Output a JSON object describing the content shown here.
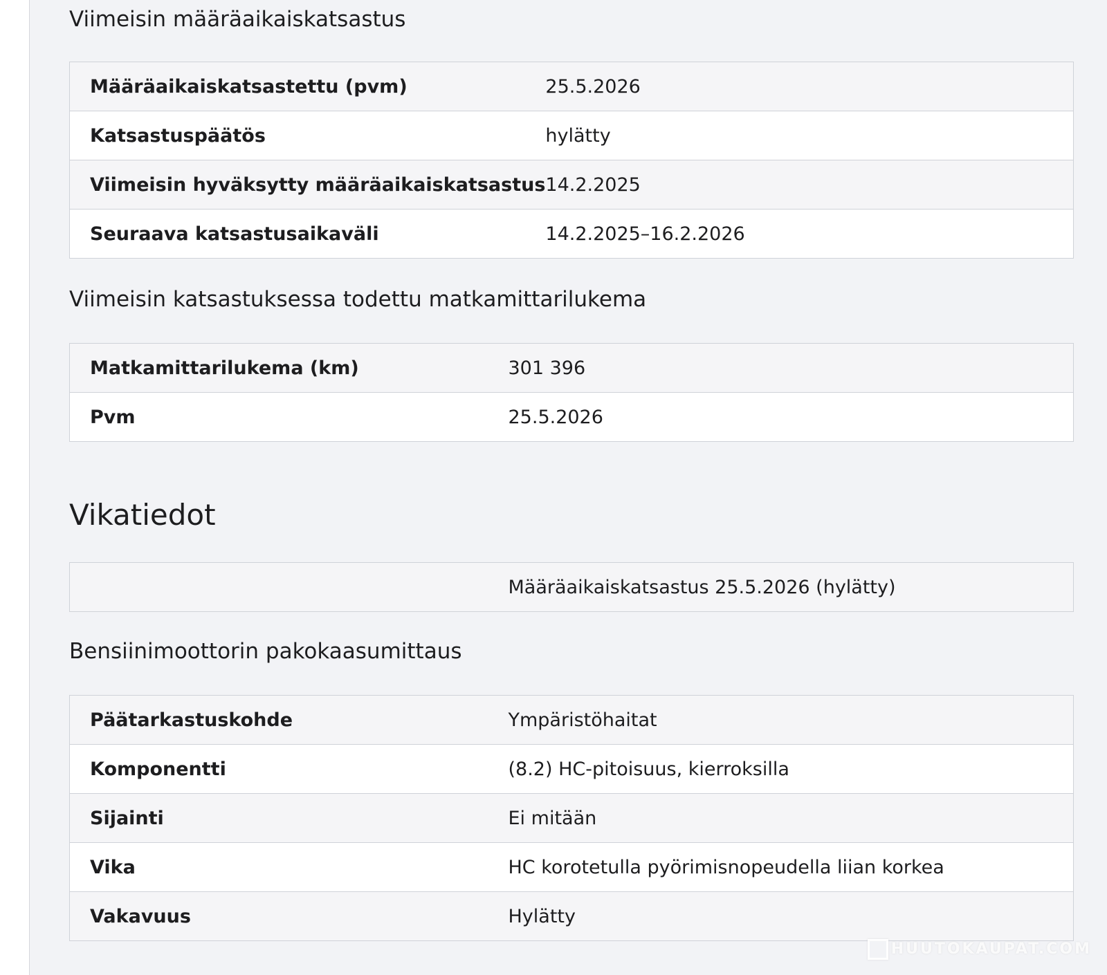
{
  "sections": {
    "inspection": {
      "title": "Viimeisin määräaikaiskatsastus",
      "rows": [
        {
          "label": "Määräaikaiskatsastettu (pvm)",
          "value": "25.5.2026"
        },
        {
          "label": "Katsastuspäätös",
          "value": "hylätty"
        },
        {
          "label": "Viimeisin hyväksytty määräaikaiskatsastus",
          "value": "14.2.2025"
        },
        {
          "label": "Seuraava katsastusaikaväli",
          "value": "14.2.2025–16.2.2026"
        }
      ]
    },
    "odometer": {
      "title": "Viimeisin katsastuksessa todettu matkamittarilukema",
      "rows": [
        {
          "label": "Matkamittarilukema (km)",
          "value": "301 396"
        },
        {
          "label": "Pvm",
          "value": "25.5.2026"
        }
      ]
    },
    "faults": {
      "heading": "Vikatiedot",
      "summary_row": {
        "label": "",
        "value": "Määräaikaiskatsastus 25.5.2026 (hylätty)"
      }
    },
    "exhaust": {
      "title": "Bensiinimoottorin pakokaasumittaus",
      "rows": [
        {
          "label": "Päätarkastuskohde",
          "value": "Ympäristöhaitat"
        },
        {
          "label": "Komponentti",
          "value": "(8.2) HC-pitoisuus, kierroksilla"
        },
        {
          "label": "Sijainti",
          "value": "Ei mitään"
        },
        {
          "label": "Vika",
          "value": "HC korotetulla pyörimisnopeudella liian korkea"
        },
        {
          "label": "Vakavuus",
          "value": "Hylätty"
        }
      ]
    }
  },
  "watermark": {
    "text": "HUUTOKAUPAT.COM"
  },
  "colors": {
    "background": "#f2f3f6",
    "row_odd": "#f5f5f7",
    "row_even": "#ffffff",
    "border": "#cfd2d8",
    "text": "#1d1d1f"
  }
}
